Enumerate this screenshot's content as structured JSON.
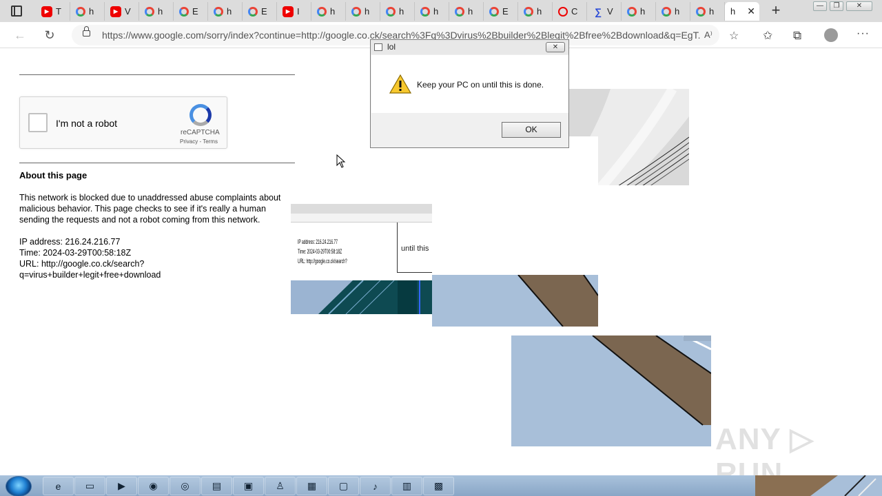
{
  "browser": {
    "tabs": [
      {
        "label": "T",
        "icon": "youtube-icon"
      },
      {
        "label": "h",
        "icon": "google-icon"
      },
      {
        "label": "V",
        "icon": "youtube-icon"
      },
      {
        "label": "h",
        "icon": "google-icon"
      },
      {
        "label": "E",
        "icon": "google-icon"
      },
      {
        "label": "h",
        "icon": "google-icon"
      },
      {
        "label": "E",
        "icon": "google-icon"
      },
      {
        "label": "I",
        "icon": "youtube-icon"
      },
      {
        "label": "h",
        "icon": "google-icon"
      },
      {
        "label": "h",
        "icon": "google-icon"
      },
      {
        "label": "h",
        "icon": "google-icon"
      },
      {
        "label": "h",
        "icon": "google-icon"
      },
      {
        "label": "h",
        "icon": "google-icon"
      },
      {
        "label": "E",
        "icon": "google-icon"
      },
      {
        "label": "h",
        "icon": "google-icon"
      },
      {
        "label": "C",
        "icon": "youtube-icon"
      },
      {
        "label": "V",
        "icon": "ms-icon"
      },
      {
        "label": "h",
        "icon": "google-icon"
      },
      {
        "label": "h",
        "icon": "google-icon"
      },
      {
        "label": "h",
        "icon": "google-icon"
      }
    ],
    "active_tab": {
      "label": "h",
      "close": "✕"
    },
    "new_tab": "+",
    "url": "https://www.google.com/sorry/index?continue=http://google.co.ck/search%3Fq%3Dvirus%2Bbuilder%2Blegit%2Bfree%2Bdownload&q=EgT...",
    "window_controls": {
      "minimize": "—",
      "restore": "❐",
      "close": "✕"
    }
  },
  "page": {
    "captcha": {
      "label": "I'm not a robot",
      "brand": "reCAPTCHA",
      "links": "Privacy - Terms"
    },
    "about_title": "About this page",
    "about_text_lines": [
      "This network is blocked due to unaddressed abuse complaints about",
      "malicious behavior. This page checks to see if it's really a human",
      "sending the requests and not a robot coming from this network."
    ],
    "ip_line": "IP address: 216.24.216.77",
    "time_line": "Time: 2024-03-29T00:58:18Z",
    "url_line_1": "URL: http://google.co.ck/search?",
    "url_line_2": "q=virus+builder+legit+free+download"
  },
  "dialog": {
    "title": "lol",
    "message": "Keep your PC on until this is done.",
    "ok_label": "OK",
    "close_label": "✕"
  },
  "glitch_fragment_text": "until this",
  "watermark": "ANY ▷ RUN",
  "colors": {
    "accent": "#4285f4",
    "youtube": "#ee0000",
    "glitch_blue": "#a8bfd9",
    "glitch_brown": "#8a6f52"
  }
}
